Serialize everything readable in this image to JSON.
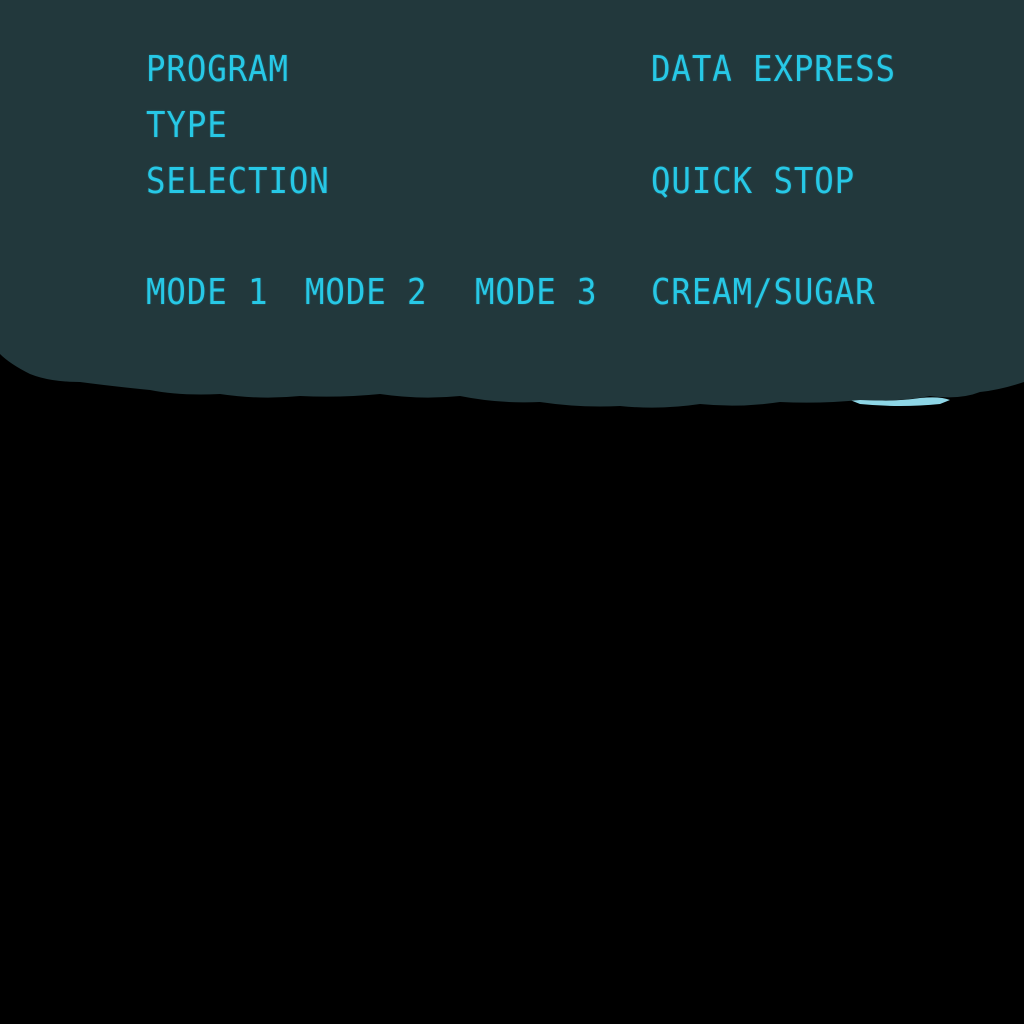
{
  "theme": {
    "panel_color": "#22383C",
    "lcd_color": "#27C8E6",
    "background_color": "#000000",
    "edge_highlight_color": "#8ED6E6"
  },
  "panel": {
    "program_label": "PROGRAM",
    "type_label": "TYPE",
    "selection_label": "SELECTION",
    "data_express": "DATA EXPRESS",
    "quick_stop": "QUICK STOP",
    "modes": [
      "MODE 1",
      "MODE 2",
      "MODE 3"
    ],
    "cream_sugar": "CREAM/SUGAR"
  }
}
